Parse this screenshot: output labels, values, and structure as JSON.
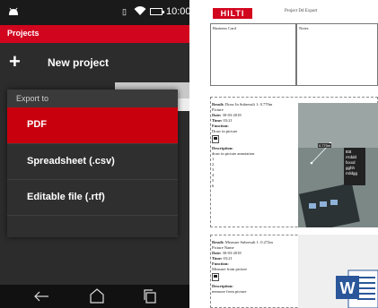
{
  "status_bar": {
    "time": "10:00",
    "sim_label": "▯"
  },
  "app_bar": {
    "title": "Projects"
  },
  "new_project": {
    "icon": "+",
    "label": "New project"
  },
  "export_dialog": {
    "header": "Export to",
    "options": [
      {
        "label": "PDF",
        "selected": true
      },
      {
        "label": "Spreadsheet (.csv)",
        "selected": false
      },
      {
        "label": "Editable file (.rtf)",
        "selected": false
      }
    ]
  },
  "colors": {
    "brand_red": "#d2051e",
    "selected_red": "#c8000e",
    "dark_bg": "#2c2c2c",
    "word_blue": "#2b579a"
  },
  "document": {
    "logo": "HILTI",
    "title": "Project Dd Export",
    "business_card": "Business Card",
    "notes": "Notes",
    "entry1": {
      "result_label": "Result:",
      "result_name": "Draw In",
      "subresult_label": "Subresult 1:",
      "subresult_value": "0.770m",
      "line_picture": "Picture",
      "date_label": "Date:",
      "date_value": "30-03-2018",
      "time_label": "Time:",
      "time_value": "03:21",
      "function_label": "Function:",
      "function_value": "Draw in picture",
      "description_label": "Description:",
      "description_value": "draw in picture annotation",
      "numbers": [
        "1",
        "2",
        "3",
        "4",
        "5",
        "6"
      ],
      "photo_measure": "0.770m",
      "photo_note": [
        "ttttt",
        "rrrddd",
        "fxxxd",
        "gghh",
        "rrddgg"
      ]
    },
    "entry2": {
      "result_label": "Result:",
      "result_name": "Measure",
      "subresult_label": "Subresult 1:",
      "subresult_value": "0.272m",
      "line_picture": "Picture Name",
      "date_label": "Date:",
      "date_value": "30-03-2018",
      "time_label": "Time:",
      "time_value": "03:21",
      "function_label": "Function:",
      "function_value": "Measure from picture",
      "description_label": "Description:",
      "description_value": "measure from picture"
    },
    "word_icon_letter": "W"
  }
}
